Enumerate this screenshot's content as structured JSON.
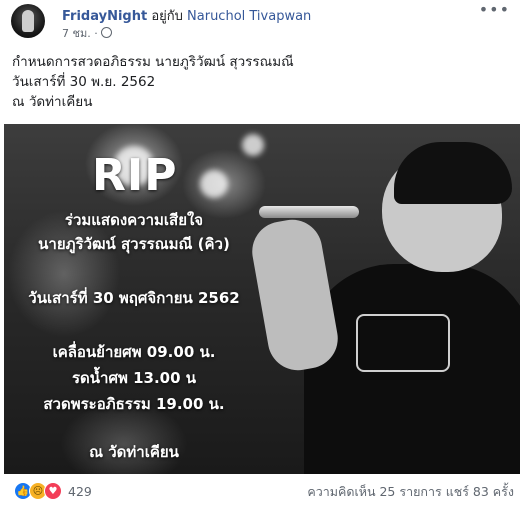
{
  "post": {
    "page_name": "FridayNight",
    "with_text": "อยู่กับ",
    "tagged_name": "Naruchol Tivapwan",
    "time": "7 ชม. ·",
    "more_icon": "more-dots-icon",
    "privacy_icon": "globe-icon",
    "text_lines": [
      "กำหนดการสวดอภิธรรม นายภูริวัฒน์ สุวรรณมณี",
      "วันเสาร์ที่ 30 พ.ย. 2562",
      "ณ วัดท่าเคียน"
    ]
  },
  "image": {
    "rip": "RIP",
    "line1": "ร่วมแสดงความเสียใจ",
    "line2": "นายภูริวัฒน์ สุวรรณมณี (คิว)",
    "date": "วันเสาร์ที่ 30 พฤศจิกายน 2562",
    "event1": "เคลื่อนย้ายศพ 09.00 น.",
    "event2": "รดน้ำศพ 13.00 น",
    "event3": "สวดพระอภิธรรม 19.00 น.",
    "place": "ณ วัดท่าเคียน"
  },
  "footer": {
    "reaction_count": "429",
    "reaction_icons": [
      "like-icon",
      "sad-icon",
      "love-icon"
    ],
    "comments": "ความคิดเห็น 25 รายการ",
    "shares": "แชร์ 83 ครั้ง"
  }
}
